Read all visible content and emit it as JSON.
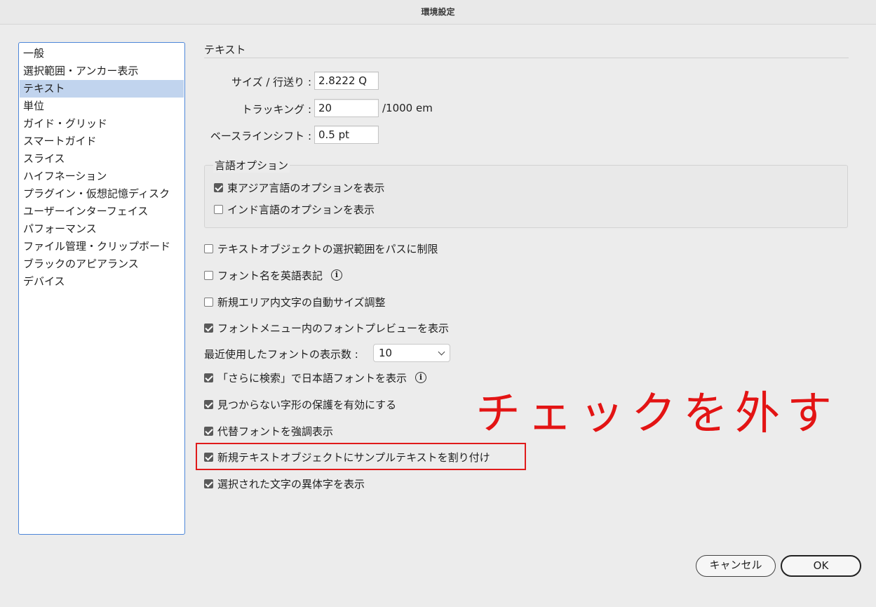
{
  "window": {
    "title": "環境設定"
  },
  "sidebar": {
    "items": [
      {
        "label": "一般"
      },
      {
        "label": "選択範囲・アンカー表示"
      },
      {
        "label": "テキスト",
        "selected": true
      },
      {
        "label": "単位"
      },
      {
        "label": "ガイド・グリッド"
      },
      {
        "label": "スマートガイド"
      },
      {
        "label": "スライス"
      },
      {
        "label": "ハイフネーション"
      },
      {
        "label": "プラグイン・仮想記憶ディスク"
      },
      {
        "label": "ユーザーインターフェイス"
      },
      {
        "label": "パフォーマンス"
      },
      {
        "label": "ファイル管理・クリップボード"
      },
      {
        "label": "ブラックのアピアランス"
      },
      {
        "label": "デバイス"
      }
    ]
  },
  "main": {
    "section_title": "テキスト",
    "size_leading": {
      "label": "サイズ / 行送り :",
      "value": "2.8222 Q"
    },
    "tracking": {
      "label": "トラッキング :",
      "value": "20",
      "unit": "/1000 em"
    },
    "baseline_shift": {
      "label": "ベースラインシフト :",
      "value": "0.5 pt"
    },
    "language_options": {
      "title": "言語オプション",
      "items": [
        {
          "label": "東アジア言語のオプションを表示",
          "checked": true
        },
        {
          "label": "インド言語のオプションを表示",
          "checked": false
        }
      ]
    },
    "options": [
      {
        "label": "テキストオブジェクトの選択範囲をパスに制限",
        "checked": false
      },
      {
        "label": "フォント名を英語表記",
        "checked": false,
        "info": true
      },
      {
        "label": "新規エリア内文字の自動サイズ調整",
        "checked": false
      },
      {
        "label": "フォントメニュー内のフォントプレビューを表示",
        "checked": true
      }
    ],
    "recent_fonts": {
      "label": "最近使用したフォントの表示数 :",
      "value": "10"
    },
    "options2": [
      {
        "label": "「さらに検索」で日本語フォントを表示",
        "checked": true,
        "info": true
      },
      {
        "label": "見つからない字形の保護を有効にする",
        "checked": true
      },
      {
        "label": "代替フォントを強調表示",
        "checked": true
      },
      {
        "label": "新規テキストオブジェクトにサンプルテキストを割り付け",
        "checked": true
      },
      {
        "label": "選択された文字の異体字を表示",
        "checked": true
      }
    ],
    "info_icon": "info-icon"
  },
  "annotation": {
    "text": "チェックを外す",
    "color": "#e31414"
  },
  "buttons": {
    "cancel": "キャンセル",
    "ok": "OK"
  }
}
